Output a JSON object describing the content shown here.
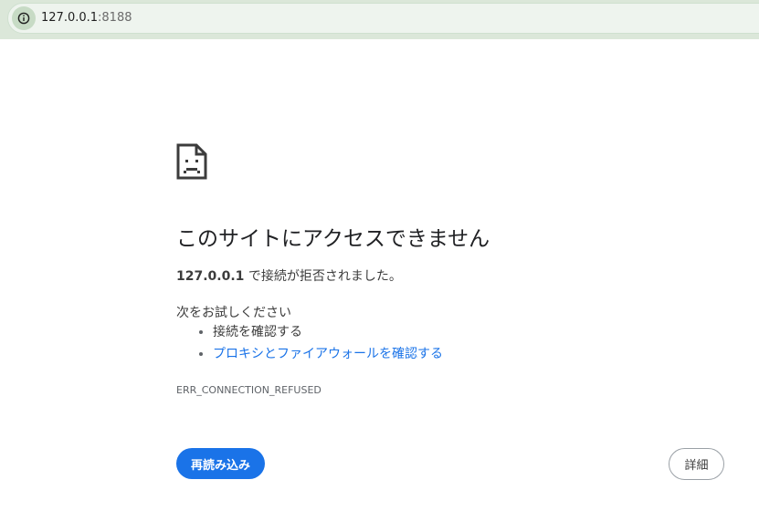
{
  "address_bar": {
    "site_info_icon": "info-circle-icon",
    "url_host": "127.0.0.1",
    "url_port": ":8188"
  },
  "error_page": {
    "icon": "sad-document-icon",
    "heading": "このサイトにアクセスできません",
    "host_bold": "127.0.0.1",
    "summary_rest": " で接続が拒否されました。",
    "suggestions_title": "次をお試しください",
    "suggestions": [
      {
        "label": "接続を確認する",
        "is_link": false
      },
      {
        "label": "プロキシとファイアウォールを確認する",
        "is_link": true
      }
    ],
    "error_code": "ERR_CONNECTION_REFUSED",
    "reload_label": "再読み込み",
    "details_label": "詳細"
  },
  "colors": {
    "primary_button": "#1a73e8",
    "link": "#1a73e8",
    "toolbar_bg": "#dbe7d9"
  }
}
